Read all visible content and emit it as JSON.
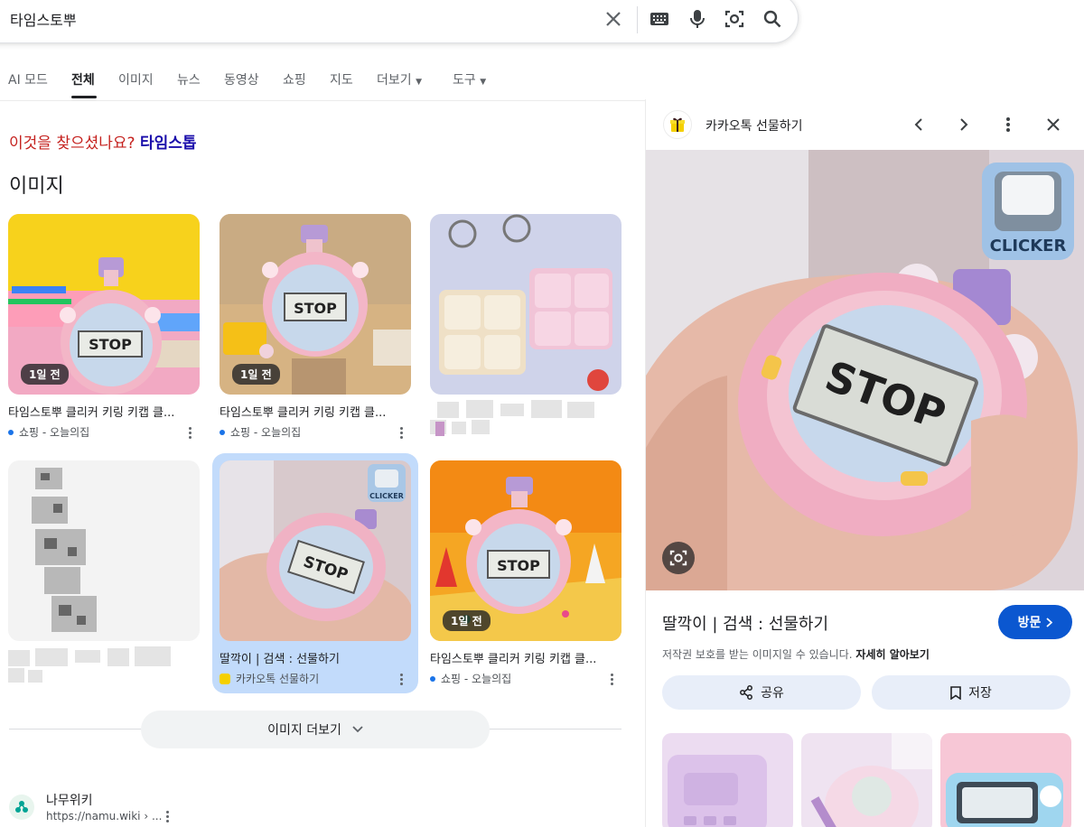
{
  "search": {
    "query": "타임스토뿌"
  },
  "tabs": [
    {
      "label": "AI 모드"
    },
    {
      "label": "전체"
    },
    {
      "label": "이미지"
    },
    {
      "label": "뉴스"
    },
    {
      "label": "동영상"
    },
    {
      "label": "쇼핑"
    },
    {
      "label": "지도"
    },
    {
      "label": "더보기"
    },
    {
      "label": "도구"
    }
  ],
  "did_you_mean": {
    "prefix": "이것을 찾으셨나요?",
    "suggestion": "타임스톱"
  },
  "images_heading": "이미지",
  "images": [
    {
      "badge": "1일 전",
      "title": "타임스토뿌 클리커 키링 키캡 클...",
      "source": "쇼핑 - 오늘의집"
    },
    {
      "badge": "1일 전",
      "title": "타임스토뿌 클리커 키링 키캡 클...",
      "source": "쇼핑 - 오늘의집"
    },
    {
      "badge": "",
      "title": "",
      "source": ""
    },
    {
      "badge": "",
      "title": "",
      "source": ""
    },
    {
      "badge": "",
      "title": "딸깍이 | 검색 : 선물하기",
      "source": "카카오톡 선물하기"
    },
    {
      "badge": "1일 전",
      "title": "타임스토뿌 클리커 키링 키캡 클...",
      "source": "쇼핑 - 오늘의집"
    }
  ],
  "thumb_text": {
    "stop": "STOP",
    "clicker": "CLICKER"
  },
  "more_images": "이미지 더보기",
  "result": {
    "site": "나무위키",
    "url": "https://namu.wiki › ..."
  },
  "panel": {
    "source_name": "카카오톡 선물하기",
    "title": "딸깍이 | 검색 : 선물하기",
    "visit_label": "방문",
    "copyright": "저작권 보호를 받는 이미지일 수 있습니다.",
    "learn_more": "자세히 알아보기",
    "share_label": "공유",
    "save_label": "저장",
    "stop_text": "STOP",
    "clicker_text": "CLICKER"
  },
  "colors": {
    "accent": "#0b57d0",
    "selected_card": "#c2dbfb",
    "did_you_mean": "#c5221f",
    "link": "#1a0dab"
  }
}
